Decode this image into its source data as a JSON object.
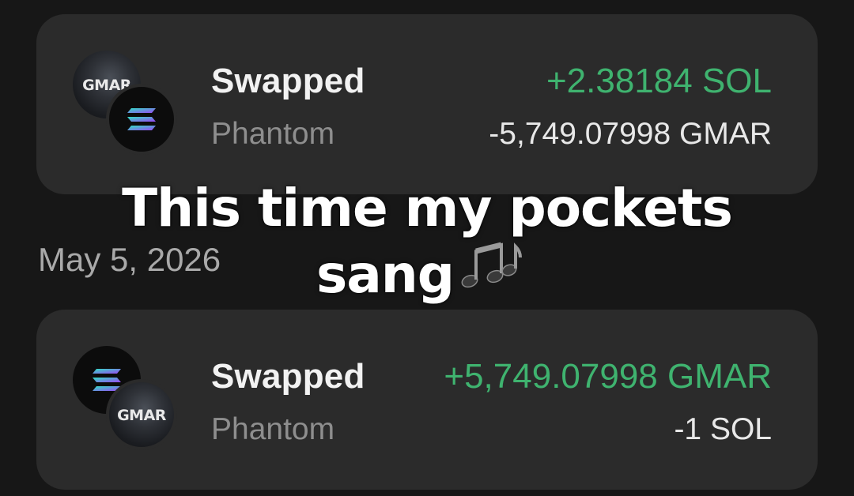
{
  "transactions": [
    {
      "title": "Swapped",
      "source": "Phantom",
      "received": "+2.38184 SOL",
      "sent": "-5,749.07998 GMAR",
      "token_back": {
        "icon": "gmar-token-icon",
        "text": "GMAR"
      },
      "token_front": {
        "icon": "solana-token-icon"
      }
    },
    {
      "title": "Swapped",
      "source": "Phantom",
      "received": "+5,749.07998 GMAR",
      "sent": "-1 SOL",
      "token_back": {
        "icon": "solana-token-icon"
      },
      "token_front": {
        "icon": "gmar-token-icon",
        "text": "GMAR"
      }
    }
  ],
  "date_header": "May 5, 2026",
  "caption": {
    "line1": "This time my pockets",
    "line2": "sang",
    "emoji": "music-notes-icon"
  },
  "colors": {
    "background": "#171717",
    "card": "#2b2b2b",
    "positive": "#3fb36f",
    "muted": "#8e8e8e"
  }
}
